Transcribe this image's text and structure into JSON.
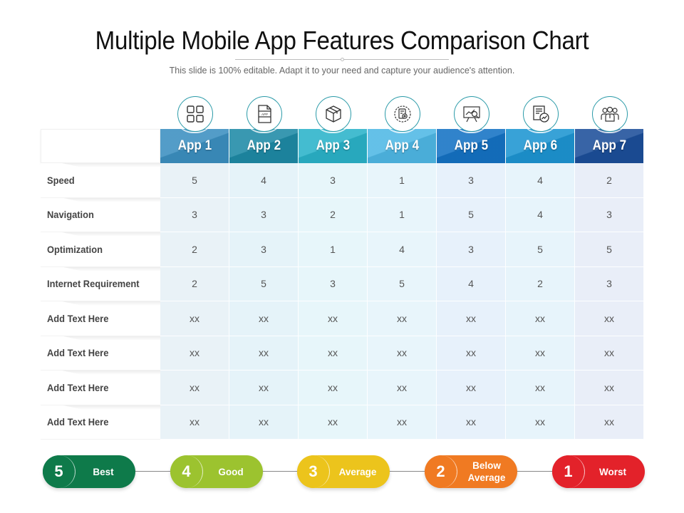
{
  "title": "Multiple Mobile App Features Comparison Chart",
  "subtitle": "This slide is 100% editable. Adapt it to your need and capture your audience's attention.",
  "apps": [
    {
      "label": "App 1",
      "icon": "grid-icon",
      "color": "#3b8fc0",
      "cell_bg": "#e9f2f7"
    },
    {
      "label": "App 2",
      "icon": "app-file-icon",
      "color": "#1e8aa6",
      "cell_bg": "#e5f3f9"
    },
    {
      "label": "App 3",
      "icon": "package-box-icon",
      "color": "#2ab3c9",
      "cell_bg": "#e7f6fa"
    },
    {
      "label": "App 4",
      "icon": "document-gear-icon",
      "color": "#4fb8e5",
      "cell_bg": "#e8f5fb"
    },
    {
      "label": "App 5",
      "icon": "presentation-analytics-icon",
      "color": "#1472c4",
      "cell_bg": "#e7f1fb"
    },
    {
      "label": "App 6",
      "icon": "report-growth-icon",
      "color": "#1d95d2",
      "cell_bg": "#e7f4fb"
    },
    {
      "label": "App 7",
      "icon": "team-people-icon",
      "color": "#1c4f9a",
      "cell_bg": "#e9eef8"
    }
  ],
  "rows": [
    {
      "label": "Speed",
      "values": [
        "5",
        "4",
        "3",
        "1",
        "3",
        "4",
        "2"
      ]
    },
    {
      "label": "Navigation",
      "values": [
        "3",
        "3",
        "2",
        "1",
        "5",
        "4",
        "3"
      ]
    },
    {
      "label": "Optimization",
      "values": [
        "2",
        "3",
        "1",
        "4",
        "3",
        "5",
        "5"
      ]
    },
    {
      "label": "Internet Requirement",
      "values": [
        "2",
        "5",
        "3",
        "5",
        "4",
        "2",
        "3"
      ]
    },
    {
      "label": "Add Text Here",
      "values": [
        "xx",
        "xx",
        "xx",
        "xx",
        "xx",
        "xx",
        "xx"
      ]
    },
    {
      "label": "Add Text Here",
      "values": [
        "xx",
        "xx",
        "xx",
        "xx",
        "xx",
        "xx",
        "xx"
      ]
    },
    {
      "label": "Add Text Here",
      "values": [
        "xx",
        "xx",
        "xx",
        "xx",
        "xx",
        "xx",
        "xx"
      ]
    },
    {
      "label": "Add Text Here",
      "values": [
        "xx",
        "xx",
        "xx",
        "xx",
        "xx",
        "xx",
        "xx"
      ]
    }
  ],
  "legend": [
    {
      "score": "5",
      "label": "Best",
      "color": "#0e7a4a"
    },
    {
      "score": "4",
      "label": "Good",
      "color": "#9cc32f"
    },
    {
      "score": "3",
      "label": "Average",
      "color": "#ecc41c"
    },
    {
      "score": "2",
      "label": "Below Average",
      "color": "#f07a22"
    },
    {
      "score": "1",
      "label": "Worst",
      "color": "#e3222a"
    }
  ]
}
